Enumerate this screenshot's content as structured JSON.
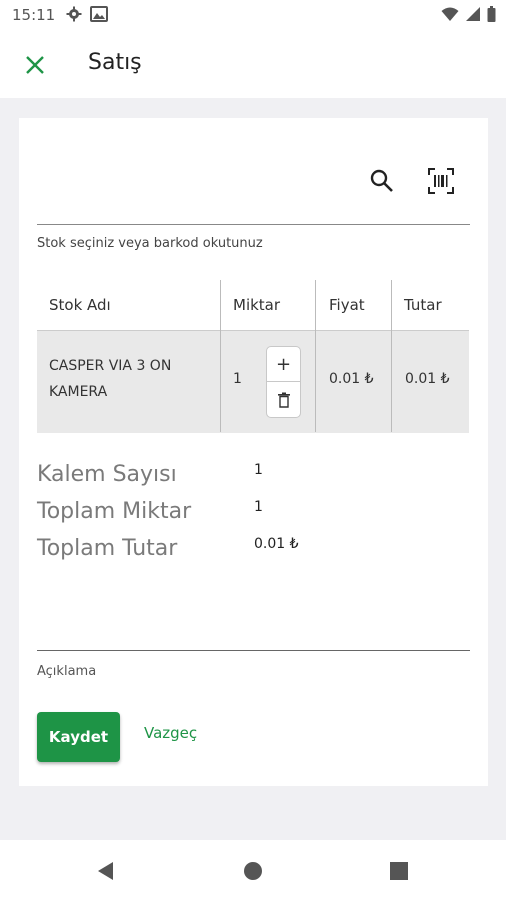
{
  "status_bar": {
    "time": "15:11",
    "left_icons": [
      "gear-icon",
      "image-icon"
    ],
    "right_icons": [
      "wifi-icon",
      "signal-icon",
      "battery-icon"
    ]
  },
  "app_bar": {
    "title": "Satış",
    "close_icon": "close-icon",
    "accent_color": "#1e9446"
  },
  "toolbar": {
    "search_icon": "search-icon",
    "scan_icon": "barcode-scan-icon"
  },
  "stock_hint": "Stok seçiniz veya barkod okutunuz",
  "table": {
    "headers": [
      "Stok Adı",
      "Miktar",
      "Fiyat",
      "Tutar"
    ],
    "rows": [
      {
        "name_line1": "CASPER VIA 3 ON",
        "name_line2": "KAMERA",
        "quantity": "1",
        "price": "0.01 ₺",
        "total": "0.01 ₺",
        "increase_label": "+"
      }
    ]
  },
  "summary": {
    "item_count_label": "Kalem Sayısı",
    "item_count_value": "1",
    "total_quantity_label": "Toplam Miktar",
    "total_quantity_value": "1",
    "total_amount_label": "Toplam Tutar",
    "total_amount_value": "0.01 ₺"
  },
  "description_label": "Açıklama",
  "actions": {
    "save_label": "Kaydet",
    "cancel_label": "Vazgeç"
  },
  "nav_bar": {
    "icons": [
      "back-icon",
      "home-icon",
      "recents-icon"
    ]
  }
}
